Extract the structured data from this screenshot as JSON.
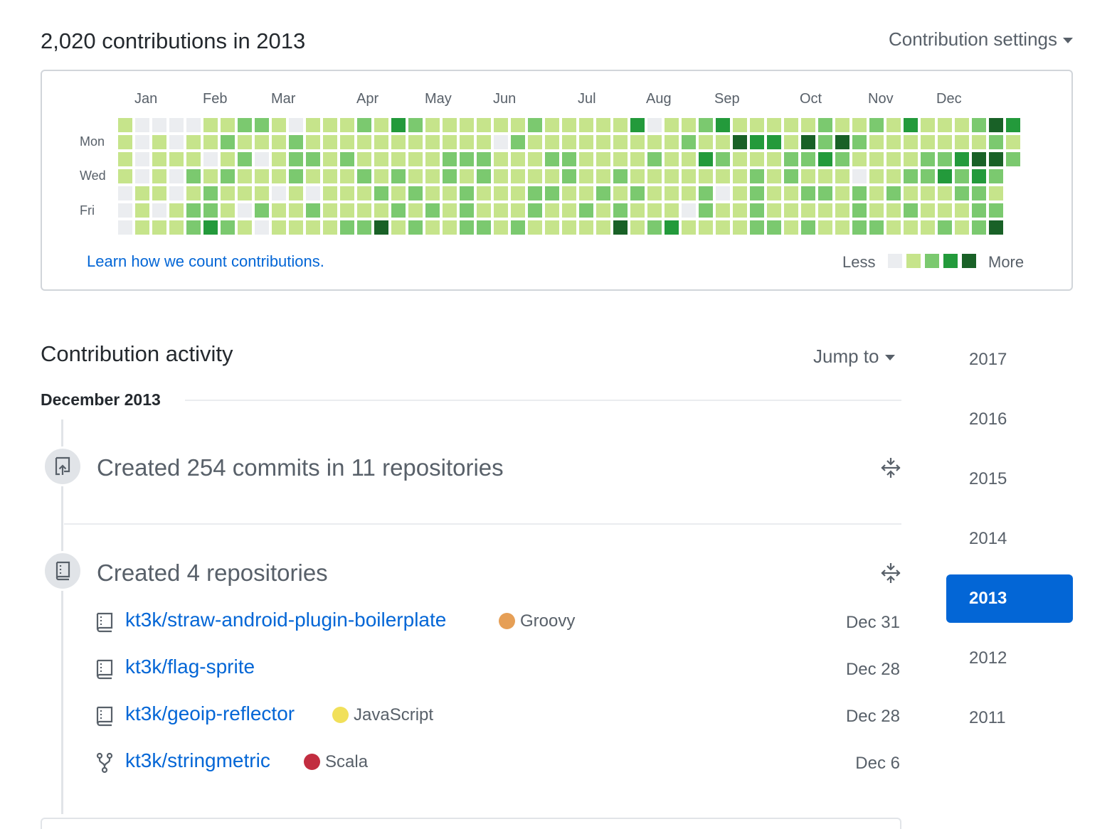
{
  "header": {
    "title": "2,020 contributions in 2013",
    "settings_label": "Contribution settings"
  },
  "calendar": {
    "months": [
      "Jan",
      "Feb",
      "Mar",
      "Apr",
      "May",
      "Jun",
      "Jul",
      "Aug",
      "Sep",
      "Oct",
      "Nov",
      "Dec"
    ],
    "day_labels": [
      "Mon",
      "Wed",
      "Fri"
    ],
    "colors": [
      "#ebedf0",
      "#c6e48b",
      "#7bc96f",
      "#239a3b",
      "#196127"
    ],
    "learn_link": "Learn how we count contributions.",
    "legend_less": "Less",
    "legend_more": "More",
    "levels": [
      "1000011221011121321111112111113011231111121121311124341121221222222222222222222222222222222222222222",
      "1010112111211111111111021111111112114331424211111112111111221111222221111111120222222222222222211111",
      "1011101201221211111222111221111211321112232111122344241122221222222222222222222222222222222222222222",
      "1010212111211121211212111121121111111212111011223232124411121222222222222222222222222222222222222222",
      "0110121110101112121121112211212111201211221212111221114411111222222222222222222222222222222222222222",
      "0101221021121111212121112112121110211211111211211122421121111222222222222222222222222222222222222222",
      "0111232101111224121122121111141231111221211221112124212124311222222222222222222222222222222222222222"
    ]
  },
  "activity": {
    "title": "Contribution activity",
    "jump_to": "Jump to",
    "month": "December 2013",
    "events": [
      {
        "title": "Created 254 commits in 11 repositories",
        "icon": "repo-push-icon"
      },
      {
        "title": "Created 4 repositories",
        "icon": "repo-icon"
      }
    ],
    "repos": [
      {
        "name": "kt3k/straw-android-plugin-boilerplate",
        "language": "Groovy",
        "lang_color": "#e69f56",
        "date": "Dec 31",
        "icon": "repo-icon"
      },
      {
        "name": "kt3k/flag-sprite",
        "language": "",
        "lang_color": "",
        "date": "Dec 28",
        "icon": "repo-icon"
      },
      {
        "name": "kt3k/geoip-reflector",
        "language": "JavaScript",
        "lang_color": "#f1e05a",
        "date": "Dec 28",
        "icon": "repo-icon"
      },
      {
        "name": "kt3k/stringmetric",
        "language": "Scala",
        "lang_color": "#c22d40",
        "date": "Dec 6",
        "icon": "fork-icon"
      }
    ]
  },
  "years": [
    "2017",
    "2016",
    "2015",
    "2014",
    "2013",
    "2012",
    "2011"
  ],
  "selected_year": "2013"
}
